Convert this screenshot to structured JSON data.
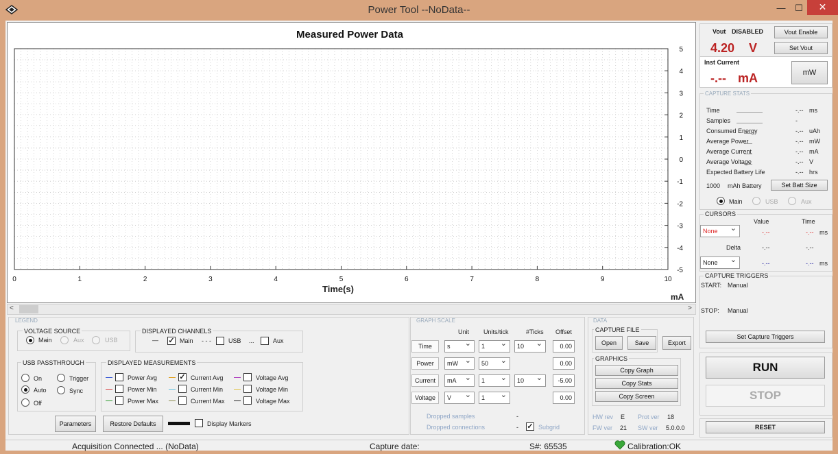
{
  "window": {
    "title": "Power Tool --NoData--",
    "minimize": "—",
    "maximize": "☐",
    "close": "✕"
  },
  "plot": {
    "title": "Measured Power Data",
    "xlabel": "Time(s)",
    "unit": "mA",
    "x_ticks": [
      "0",
      "1",
      "2",
      "3",
      "4",
      "5",
      "6",
      "7",
      "8",
      "9",
      "10"
    ],
    "y_ticks": [
      "5",
      "4",
      "3",
      "2",
      "1",
      "0",
      "-1",
      "-2",
      "-3",
      "-4",
      "-5"
    ],
    "scroll_left": "<",
    "scroll_right": ">"
  },
  "legend": {
    "title": "LEGEND",
    "voltage_source": {
      "title": "VOLTAGE SOURCE",
      "options": [
        "Main",
        "Aux",
        "USB"
      ],
      "selected": "Main"
    },
    "displayed_channels": {
      "title": "DISPLAYED CHANNELS",
      "main": "Main",
      "usb": "USB",
      "aux": "Aux",
      "main_style": "—",
      "usb_style": "- - -",
      "aux_style": "..."
    },
    "usb_passthrough": {
      "title": "USB PASSTHROUGH",
      "on": "On",
      "auto": "Auto",
      "off": "Off",
      "trigger": "Trigger",
      "sync": "Sync",
      "selected": "Auto"
    },
    "displayed_measurements": {
      "title": "DISPLAYED MEASUREMENTS",
      "items": [
        {
          "label": "Power Avg",
          "color": "#3a5bd6",
          "checked": false
        },
        {
          "label": "Power Min",
          "color": "#d63a3a",
          "checked": false
        },
        {
          "label": "Power Max",
          "color": "#2a9a2a",
          "checked": false
        },
        {
          "label": "Current Avg",
          "color": "#e0a020",
          "checked": true
        },
        {
          "label": "Current Min",
          "color": "#60c0e0",
          "checked": false
        },
        {
          "label": "Current Max",
          "color": "#8a8a4a",
          "checked": false
        },
        {
          "label": "Voltage Avg",
          "color": "#b040c0",
          "checked": false
        },
        {
          "label": "Voltage Min",
          "color": "#e0c040",
          "checked": false
        },
        {
          "label": "Voltage Max",
          "color": "#222222",
          "checked": false
        }
      ]
    },
    "parameters_button": "Parameters",
    "restore_defaults_button": "Restore Defaults",
    "display_markers": "Display Markers"
  },
  "graph_scale": {
    "title": "GRAPH SCALE",
    "headers": [
      "Unit",
      "Units/tick",
      "#Ticks",
      "Offset"
    ],
    "rows": [
      {
        "label": "Time",
        "unit": "s",
        "units_per_tick": "1",
        "ticks": "10",
        "offset": "0.00"
      },
      {
        "label": "Power",
        "unit": "mW",
        "units_per_tick": "50",
        "ticks": "",
        "offset": "0.00"
      },
      {
        "label": "Current",
        "unit": "mA",
        "units_per_tick": "1",
        "ticks": "10",
        "offset": "-5.00"
      },
      {
        "label": "Voltage",
        "unit": "V",
        "units_per_tick": "1",
        "ticks": "",
        "offset": "0.00"
      }
    ],
    "dropped_samples": "Dropped samples",
    "dropped_samples_value": "-",
    "dropped_connections": "Dropped connections",
    "dropped_connections_value": "-",
    "subgrid": "Subgrid"
  },
  "data": {
    "title": "DATA",
    "capture_file": "CAPTURE FILE",
    "open": "Open",
    "save": "Save",
    "export": "Export",
    "graphics": "GRAPHICS",
    "copy_graph": "Copy Graph",
    "copy_stats": "Copy Stats",
    "copy_screen": "Copy Screen",
    "hw_rev_label": "HW rev",
    "hw_rev": "E",
    "prot_ver_label": "Prot ver",
    "prot_ver": "18",
    "fw_ver_label": "FW ver",
    "fw_ver": "21",
    "sw_ver_label": "SW ver",
    "sw_ver": "5.0.0.0"
  },
  "right": {
    "vout_label": "Vout",
    "vout_state": "DISABLED",
    "vout_value": "4.20",
    "vout_unit": "V",
    "vout_enable": "Vout Enable",
    "set_vout": "Set Vout",
    "inst_current_label": "Inst Current",
    "inst_current_value": "-.--",
    "inst_current_unit": "mA",
    "mw_button": "mW",
    "capture_stats_title": "CAPTURE STATS",
    "stats": [
      {
        "label": "Time",
        "value": "-.--",
        "unit": "ms"
      },
      {
        "label": "Samples",
        "value": "-",
        "unit": ""
      },
      {
        "label": "Consumed Energy",
        "value": "-.--",
        "unit": "uAh"
      },
      {
        "label": "Average Power",
        "value": "-.--",
        "unit": "mW"
      },
      {
        "label": "Average Current",
        "value": "-.--",
        "unit": "mA"
      },
      {
        "label": "Average Voltage",
        "value": "-.--",
        "unit": "V"
      },
      {
        "label": "Expected Battery Life",
        "value": "-.--",
        "unit": "hrs"
      }
    ],
    "battery_size": "1000",
    "battery_label": "mAh Battery",
    "set_batt_size": "Set Batt Size",
    "source_options": [
      "Main",
      "USB",
      "Aux"
    ],
    "cursors_title": "CURSORS",
    "cursor_value_header": "Value",
    "cursor_time_header": "Time",
    "cursor1_select": "None",
    "cursor1_value": "-.--",
    "cursor1_time": "-.--",
    "cursor_unit": "ms",
    "delta_label": "Delta",
    "delta_value": "-.--",
    "delta_time": "-.--",
    "cursor2_select": "None",
    "cursor2_value": "-.--",
    "cursor2_time": "-.--",
    "capture_triggers_title": "CAPTURE TRIGGERS",
    "start_label": "START:",
    "start_value": "Manual",
    "stop_label": "STOP:",
    "stop_value": "Manual",
    "set_capture_triggers": "Set Capture Triggers",
    "run": "RUN",
    "stop": "STOP",
    "reset": "RESET"
  },
  "status": {
    "acquisition": "Acquisition Connected ... (NoData)",
    "capture_date": "Capture date:",
    "serial": "S#: 65535",
    "calibration": "Calibration:OK",
    "calibration_color": "#3aa83a"
  },
  "chart_data": {
    "type": "line",
    "title": "Measured Power Data",
    "xlabel": "Time(s)",
    "ylabel": "mA",
    "xlim": [
      0,
      10
    ],
    "ylim": [
      -5,
      5
    ],
    "x_ticks": [
      0,
      1,
      2,
      3,
      4,
      5,
      6,
      7,
      8,
      9,
      10
    ],
    "y_ticks": [
      5,
      4,
      3,
      2,
      1,
      0,
      -1,
      -2,
      -3,
      -4,
      -5
    ],
    "series": [],
    "grid": true
  }
}
